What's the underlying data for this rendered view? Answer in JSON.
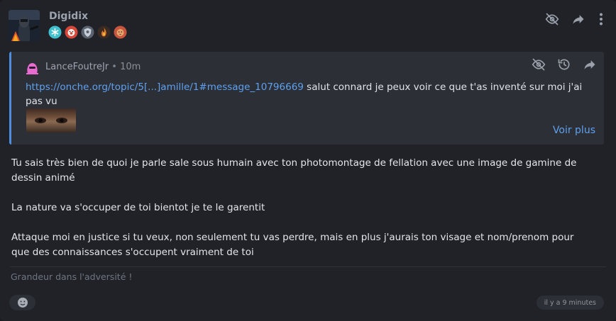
{
  "post": {
    "author": "Digidix",
    "avatar_icon": "soldier-avatar",
    "badges": [
      {
        "icon": "blue-snowflake-badge",
        "color": "#3fc0cf"
      },
      {
        "icon": "red-clown-badge",
        "color": "#d9463a"
      },
      {
        "icon": "grey-shield-badge",
        "color": "#8f98a6"
      },
      {
        "icon": "flame-badge",
        "color": "#e07a2a"
      },
      {
        "icon": "lion-badge",
        "color": "#c8553e"
      }
    ],
    "actions": {
      "hide_icon": "eye-off-icon",
      "share_icon": "share-arrow-icon",
      "more_icon": "more-vertical-icon"
    },
    "quote": {
      "author": "LanceFoutreJr",
      "separator": "•",
      "time": "10m",
      "link_text": "https://onche.org/topic/5[...]amille/1#message_10796669",
      "text": " salut connard je peux voir ce que t'as inventé sur moi j'ai pas vu",
      "see_more": "Voir plus"
    },
    "body": [
      "Tu sais très bien de quoi je parle sale sous humain avec ton photomontage de fellation avec une image de gamine de dessin animé",
      "La nature va s'occuper de toi bientot je te le garentit",
      "Attaque moi en justice si tu veux, non seulement tu vas perdre, mais en plus j'aurais ton visage et nom/prenom pour que des connaissances s'occupent vraiment de toi"
    ],
    "signature": "Grandeur dans l'adversité !",
    "timestamp": "il y a 9 minutes"
  },
  "colors": {
    "background": "#202228",
    "quote_bg": "#2c2f36",
    "quote_border": "#4e8ee0",
    "link": "#5ea1f0"
  }
}
